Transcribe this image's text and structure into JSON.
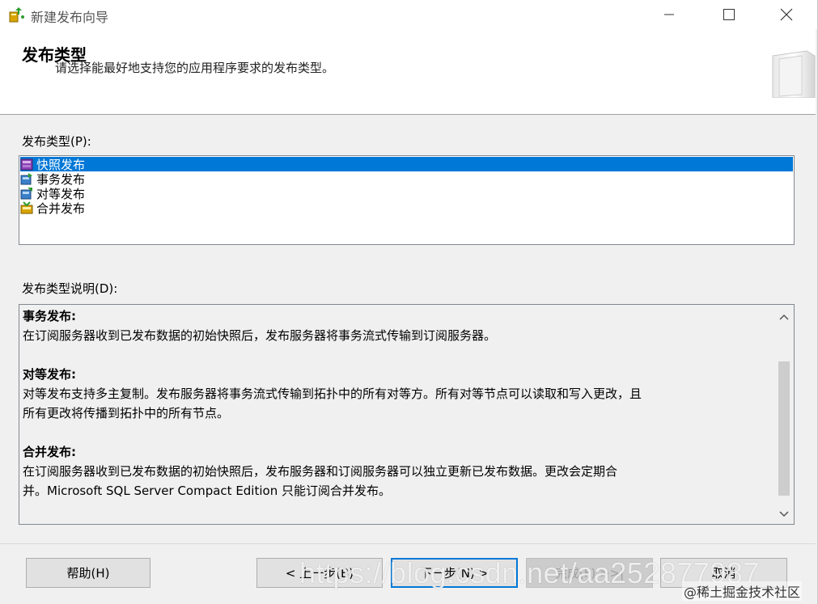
{
  "window": {
    "title": "新建发布向导"
  },
  "header": {
    "title": "发布类型",
    "subtitle": "请选择能最好地支持您的应用程序要求的发布类型。"
  },
  "publication_types": {
    "label": "发布类型(P):",
    "items": [
      {
        "label": "快照发布",
        "icon": "snapshot-publication-icon",
        "selected": true
      },
      {
        "label": "事务发布",
        "icon": "transactional-publication-icon",
        "selected": false
      },
      {
        "label": "对等发布",
        "icon": "peer-to-peer-publication-icon",
        "selected": false
      },
      {
        "label": "合并发布",
        "icon": "merge-publication-icon",
        "selected": false
      }
    ]
  },
  "description": {
    "label": "发布类型说明(D):",
    "sections": [
      {
        "heading": "事务发布:",
        "lines": [
          "在订阅服务器收到已发布数据的初始快照后，发布服务器将事务流式传输到订阅服务器。"
        ]
      },
      {
        "heading": "对等发布:",
        "lines": [
          "对等发布支持多主复制。发布服务器将事务流式传输到拓扑中的所有对等方。所有对等节点可以读取和写入更改，且",
          "所有更改将传播到拓扑中的所有节点。"
        ]
      },
      {
        "heading": "合并发布:",
        "lines": [
          "在订阅服务器收到已发布数据的初始快照后，发布服务器和订阅服务器可以独立更新已发布数据。更改会定期合",
          "并。Microsoft SQL Server Compact Edition 只能订阅合并发布。"
        ]
      }
    ]
  },
  "buttons": {
    "help": "帮助(H)",
    "back": "< 上一步(B)",
    "next": "下一步(N) >",
    "finish": "完成(F) >>|",
    "cancel": "取消"
  },
  "watermark": {
    "url": "https://blog.csdn.net/aa252877987",
    "community": "@稀土掘金技术社区"
  },
  "colors": {
    "selection": "#0078d7",
    "window_bg": "#f0f0f0"
  }
}
